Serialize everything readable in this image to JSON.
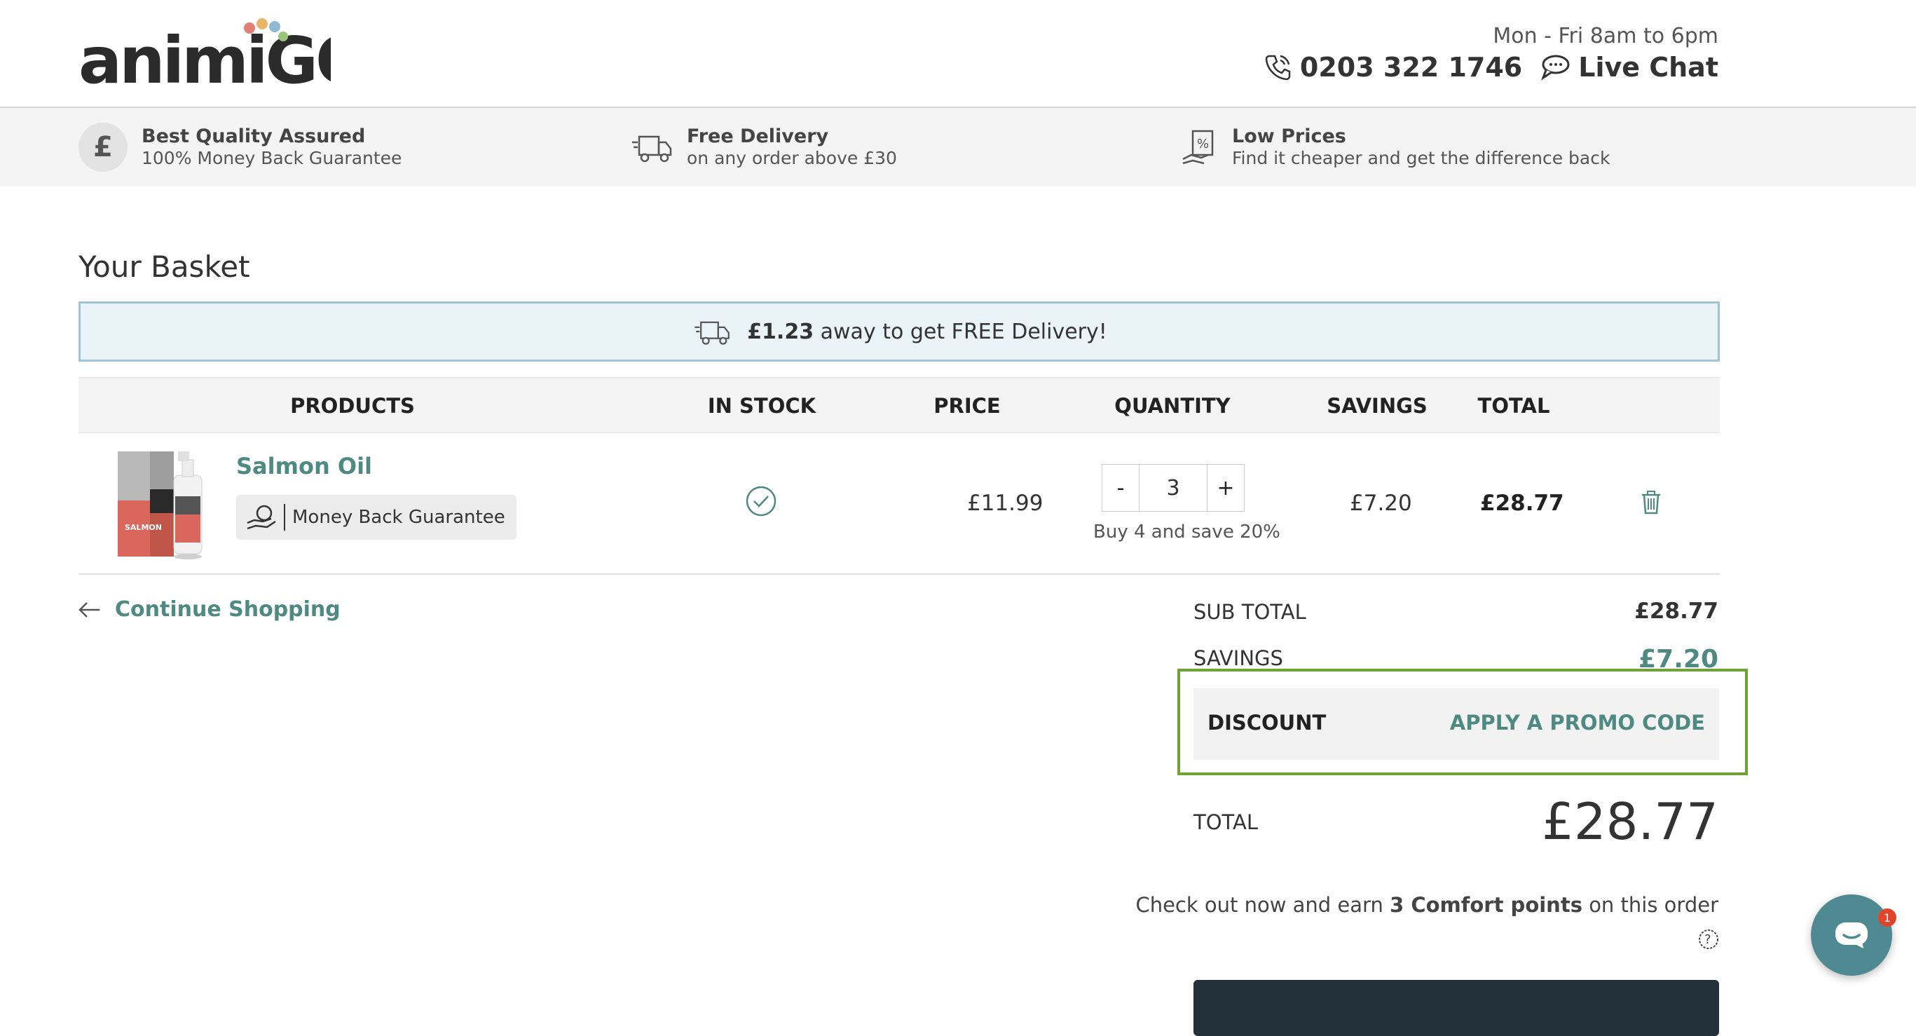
{
  "header": {
    "logo_text": "animiGO",
    "hours": "Mon - Fri 8am to 6pm",
    "phone": "0203 322 1746",
    "live_chat": "Live Chat"
  },
  "usp": [
    {
      "title": "Best Quality Assured",
      "subtitle": "100% Money Back Guarantee",
      "icon": "pound-icon"
    },
    {
      "title": "Free Delivery",
      "subtitle": "on any order above £30",
      "icon": "delivery-truck-icon"
    },
    {
      "title": "Low Prices",
      "subtitle": "Find it cheaper and get the difference back",
      "icon": "price-tag-icon"
    }
  ],
  "basket": {
    "title": "Your Basket",
    "free_delivery": {
      "amount": "£1.23",
      "text": "away to get FREE Delivery!"
    },
    "columns": [
      "PRODUCTS",
      "IN STOCK",
      "PRICE",
      "QUANTITY",
      "SAVINGS",
      "TOTAL"
    ],
    "items": [
      {
        "name": "Salmon Oil",
        "badge": "Money Back Guarantee",
        "in_stock": true,
        "price": "£11.99",
        "quantity": "3",
        "qty_minus": "-",
        "qty_plus": "+",
        "offer": "Buy 4 and save 20%",
        "savings": "£7.20",
        "total": "£28.77",
        "image_label": "SALMON OIL"
      }
    ],
    "continue_shopping": "Continue Shopping"
  },
  "summary": {
    "subtotal_label": "SUB TOTAL",
    "subtotal": "£28.77",
    "savings_label": "SAVINGS",
    "savings": "£7.20",
    "discount_label": "DISCOUNT",
    "promo_link": "APPLY A PROMO CODE",
    "total_label": "TOTAL",
    "total": "£28.77",
    "points_pre": "Check out now and earn",
    "points_bold": "3 Comfort points",
    "points_post": "on this order"
  },
  "chat_widget": {
    "badge": "1"
  },
  "colors": {
    "accent": "#4f8a82",
    "highlight": "#6fa235",
    "banner_border": "#9fc3d9",
    "dark_button": "#23313a"
  }
}
